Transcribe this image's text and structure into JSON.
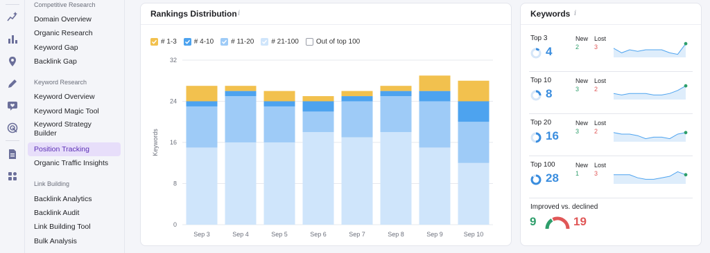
{
  "sidebar": {
    "sections": [
      {
        "heading": "Competitive Research",
        "items": [
          "Domain Overview",
          "Organic Research",
          "Keyword Gap",
          "Backlink Gap"
        ]
      },
      {
        "heading": "Keyword Research",
        "items": [
          "Keyword Overview",
          "Keyword Magic Tool",
          "Keyword Strategy Builder",
          "Position Tracking",
          "Organic Traffic Insights"
        ]
      },
      {
        "heading": "Link Building",
        "items": [
          "Backlink Analytics",
          "Backlink Audit",
          "Link Building Tool",
          "Bulk Analysis"
        ]
      }
    ],
    "active_item": "Position Tracking"
  },
  "rail_icons": [
    "sparkle-chart-icon",
    "bar-chart-icon",
    "location-pin-icon",
    "pencil-icon",
    "chat-heart-icon",
    "target-icon",
    "document-icon",
    "apps-icon"
  ],
  "rankings": {
    "title": "Rankings Distribution",
    "info": "i",
    "legend": [
      {
        "label": "# 1-3",
        "color": "#f2c14e",
        "checked": true
      },
      {
        "label": "# 4-10",
        "color": "#4da3ef",
        "checked": true
      },
      {
        "label": "# 11-20",
        "color": "#9ecbf7",
        "checked": true
      },
      {
        "label": "# 21-100",
        "color": "#cfe5fb",
        "checked": true
      },
      {
        "label": "Out of top 100",
        "color": "#ffffff",
        "checked": false
      }
    ]
  },
  "chart_data": {
    "type": "bar",
    "stacked": true,
    "categories": [
      "Sep 3",
      "Sep 4",
      "Sep 5",
      "Sep 6",
      "Sep 7",
      "Sep 8",
      "Sep 9",
      "Sep 10"
    ],
    "series": [
      {
        "name": "# 21-100",
        "color": "#cfe5fb",
        "values": [
          15,
          16,
          16,
          18,
          17,
          18,
          15,
          12
        ]
      },
      {
        "name": "# 11-20",
        "color": "#9ecbf7",
        "values": [
          8,
          9,
          7,
          4,
          7,
          7,
          9,
          8
        ]
      },
      {
        "name": "# 4-10",
        "color": "#4da3ef",
        "values": [
          1,
          1,
          1,
          2,
          1,
          1,
          2,
          4
        ]
      },
      {
        "name": "# 1-3",
        "color": "#f2c14e",
        "values": [
          3,
          1,
          2,
          1,
          1,
          1,
          3,
          4
        ]
      }
    ],
    "ylabel": "Keywords",
    "yticks": [
      "0",
      "8",
      "16",
      "24",
      "32"
    ],
    "ylim": [
      0,
      32
    ],
    "grid": true
  },
  "keywords": {
    "title": "Keywords",
    "info": "i",
    "rows": [
      {
        "label": "Top 3",
        "value": "4",
        "new_label": "New",
        "lost_label": "Lost",
        "new": "2",
        "lost": "3",
        "ring_fraction": 0.12,
        "trend": [
          6,
          3,
          5,
          4,
          5,
          5,
          5,
          3,
          2,
          9
        ]
      },
      {
        "label": "Top 10",
        "value": "8",
        "new_label": "New",
        "lost_label": "Lost",
        "new": "3",
        "lost": "2",
        "ring_fraction": 0.25,
        "trend": [
          4,
          3,
          4,
          4,
          4,
          3,
          3,
          4,
          6,
          9
        ]
      },
      {
        "label": "Top 20",
        "value": "16",
        "new_label": "New",
        "lost_label": "Lost",
        "new": "3",
        "lost": "2",
        "ring_fraction": 0.5,
        "trend": [
          6,
          5,
          5,
          4,
          2,
          3,
          3,
          2,
          5,
          6
        ]
      },
      {
        "label": "Top 100",
        "value": "28",
        "new_label": "New",
        "lost_label": "Lost",
        "new": "1",
        "lost": "3",
        "ring_fraction": 0.87,
        "trend": [
          6,
          6,
          6,
          4,
          3,
          3,
          4,
          5,
          8,
          6
        ]
      }
    ],
    "improved_label": "Improved vs. declined",
    "improved": "9",
    "declined": "19",
    "improved_color": "#2e9e6b",
    "declined_color": "#e05757"
  }
}
